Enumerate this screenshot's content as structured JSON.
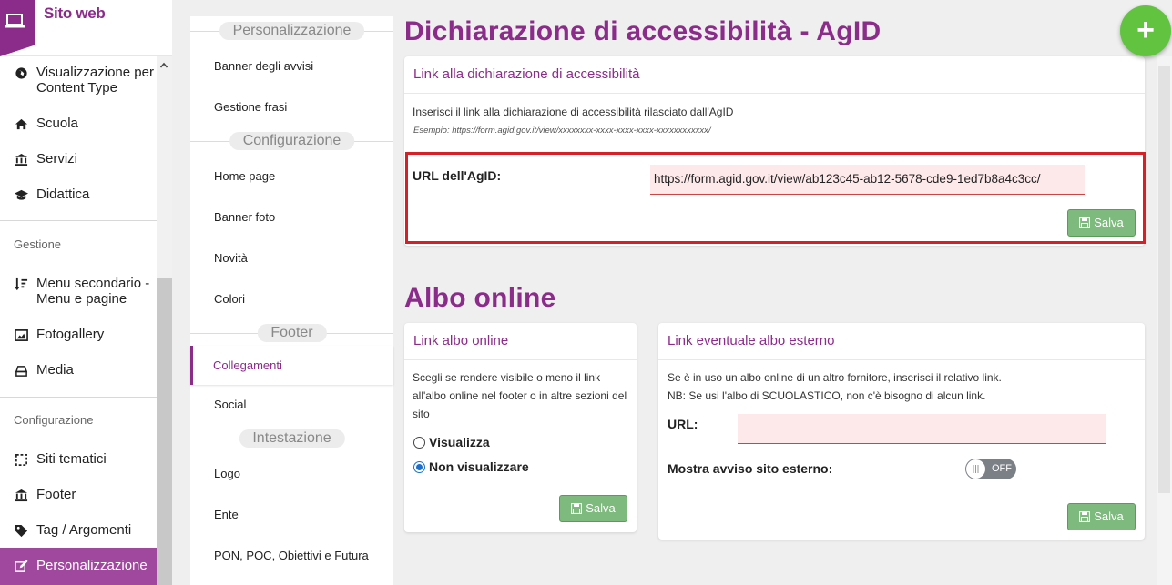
{
  "brand": {
    "title": "Sito web",
    "icon": "laptop-icon"
  },
  "sidebar": {
    "items_top": [
      {
        "label": "Visualizzazione per Content Type",
        "icon": "globe-icon"
      },
      {
        "label": "Scuola",
        "icon": "home-icon"
      },
      {
        "label": "Servizi",
        "icon": "bank-icon"
      },
      {
        "label": "Didattica",
        "icon": "graduation-cap-icon"
      }
    ],
    "section_gestione": "Gestione",
    "items_gestione": [
      {
        "label": "Menu secondario - Menu e pagine",
        "icon": "sort-icon"
      },
      {
        "label": "Fotogallery",
        "icon": "image-icon"
      },
      {
        "label": "Media",
        "icon": "hdd-icon"
      }
    ],
    "section_configurazione": "Configurazione",
    "items_configurazione": [
      {
        "label": "Siti tematici",
        "icon": "crop-icon"
      },
      {
        "label": "Footer",
        "icon": "bank-icon"
      },
      {
        "label": "Tag / Argomenti",
        "icon": "tag-icon"
      },
      {
        "label": "Personalizzazione",
        "icon": "edit-icon"
      }
    ]
  },
  "subnav": {
    "sections": [
      {
        "title": "Personalizzazione",
        "items": [
          "Banner degli avvisi",
          "Gestione frasi"
        ]
      },
      {
        "title": "Configurazione",
        "items": [
          "Home page",
          "Banner foto",
          "Novità",
          "Colori"
        ]
      },
      {
        "title": "Footer",
        "items": [
          "Collegamenti",
          "Social"
        ]
      },
      {
        "title": "Intestazione",
        "items": [
          "Logo",
          "Ente",
          "PON, POC, Obiettivi e Futura"
        ]
      }
    ],
    "active": "Collegamenti"
  },
  "accessibility": {
    "heading": "Dichiarazione di accessibilità - AgID",
    "card_title": "Link alla dichiarazione di accessibilità",
    "description": "Inserisci il link alla dichiarazione di accessibilità rilasciato dall'AgID",
    "example": "Esempio: https://form.agid.gov.it/view/xxxxxxxx-xxxx-xxxx-xxxx-xxxxxxxxxxxx/",
    "url_label": "URL dell'AgID:",
    "url_value": "https://form.agid.gov.it/view/ab123c45-ab12-5678-cde9-1ed7b8a4c3cc/",
    "save_label": "Salva"
  },
  "albo": {
    "heading": "Albo online",
    "left_card": {
      "title": "Link albo online",
      "description": "Scegli se rendere visibile o meno il link all'albo online nel footer o in altre sezioni del sito",
      "options": [
        "Visualizza",
        "Non visualizzare"
      ],
      "selected": "Non visualizzare",
      "save_label": "Salva"
    },
    "right_card": {
      "title": "Link eventuale albo esterno",
      "line1": "Se è in uso un albo online di un altro fornitore, inserisci il relativo link.",
      "line2": "NB: Se usi l'albo di SCUOLASTICO, non c'è bisogno di alcun link.",
      "url_label": "URL:",
      "url_value": "",
      "notice_label": "Mostra avviso sito esterno:",
      "toggle_state": "OFF",
      "save_label": "Salva"
    }
  },
  "fab_label": "+",
  "colors": {
    "accent": "#8b2b8a",
    "save": "#7eb97e",
    "fab": "#62c341",
    "highlight": "#d62027"
  }
}
